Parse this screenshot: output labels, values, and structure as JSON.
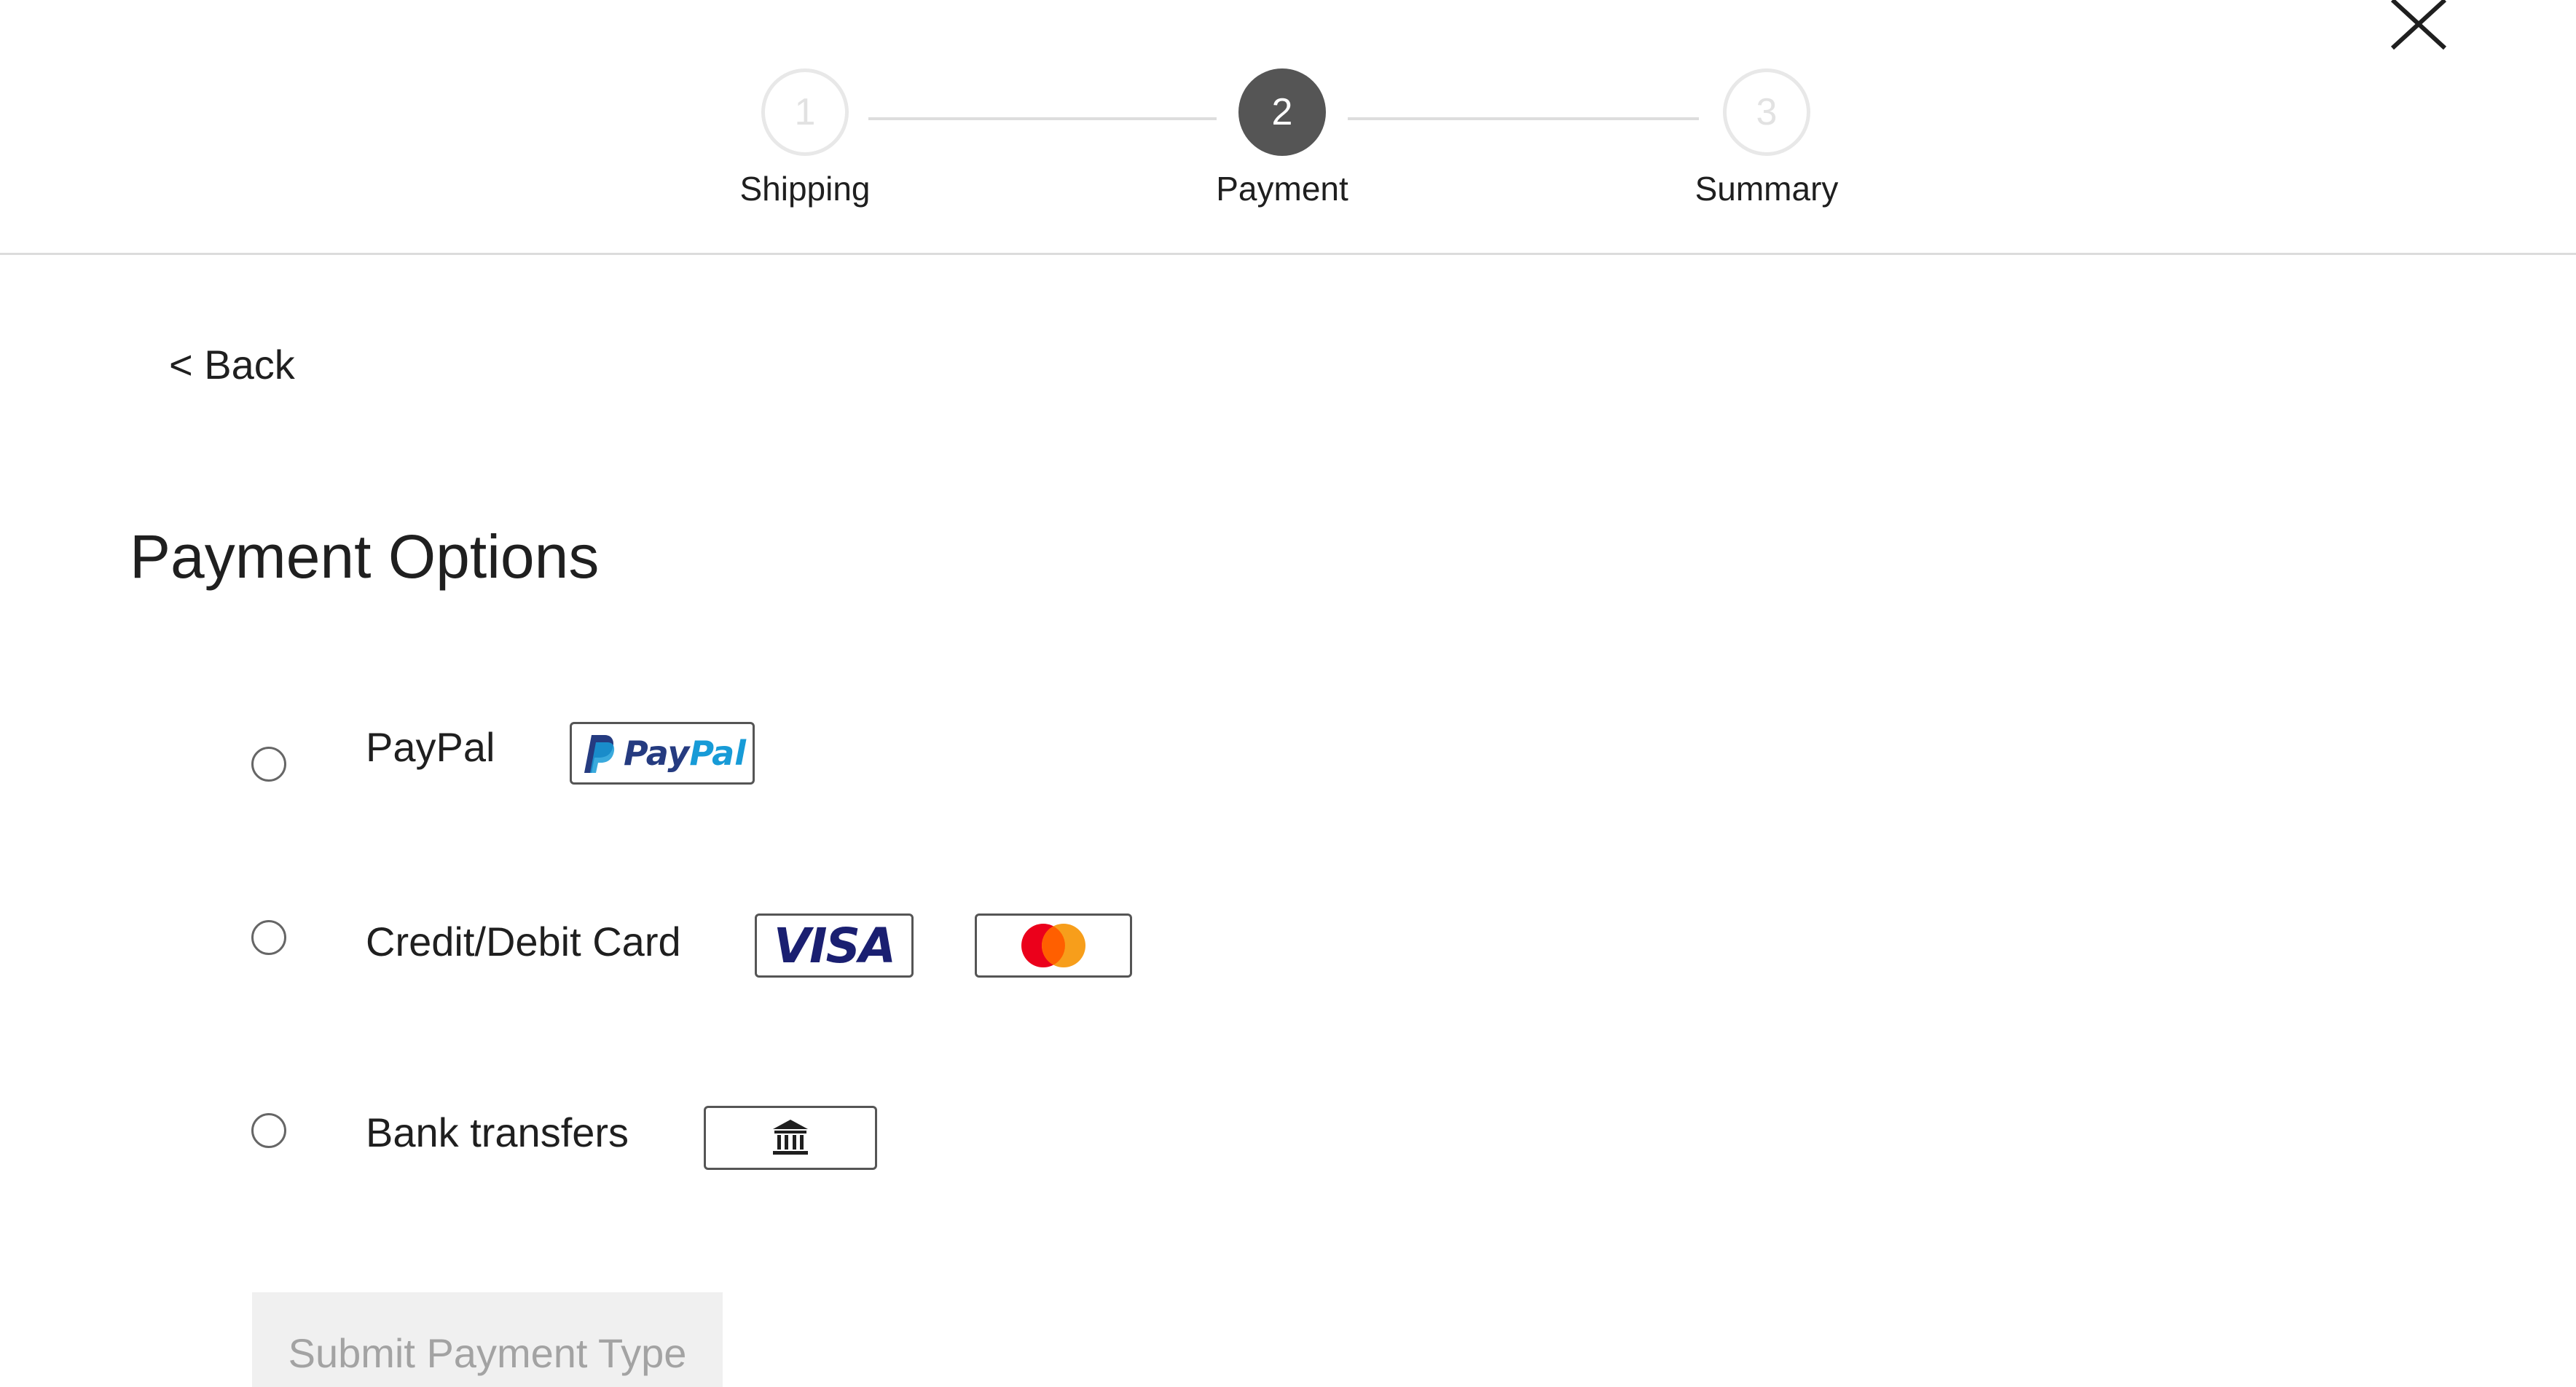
{
  "stepper": {
    "steps": [
      {
        "number": "1",
        "label": "Shipping",
        "state": "inactive"
      },
      {
        "number": "2",
        "label": "Payment",
        "state": "active"
      },
      {
        "number": "3",
        "label": "Summary",
        "state": "inactive"
      }
    ]
  },
  "back": {
    "label": "< Back"
  },
  "page_title": "Payment Options",
  "options": [
    {
      "label": "PayPal",
      "selected": false,
      "logos": [
        "paypal-logo"
      ]
    },
    {
      "label": "Credit/Debit Card",
      "selected": false,
      "logos": [
        "visa-logo",
        "mastercard-logo"
      ]
    },
    {
      "label": "Bank transfers",
      "selected": false,
      "logos": [
        "bank-icon"
      ]
    }
  ],
  "logo_text": {
    "paypal_pay": "Pay",
    "paypal_pal": "Pal",
    "visa": "VISA"
  },
  "submit": {
    "label": "Submit Payment Type",
    "enabled": false
  },
  "colors": {
    "active_step": "#555555",
    "inactive_step_border": "#e8e8e8",
    "paypal_dark": "#253b80",
    "paypal_light": "#179bd7",
    "visa_blue": "#1a1f71",
    "mastercard_red": "#eb001b",
    "mastercard_orange": "#f79e1b",
    "submit_bg": "#f0f0f0",
    "submit_text": "#a3a3a3"
  }
}
